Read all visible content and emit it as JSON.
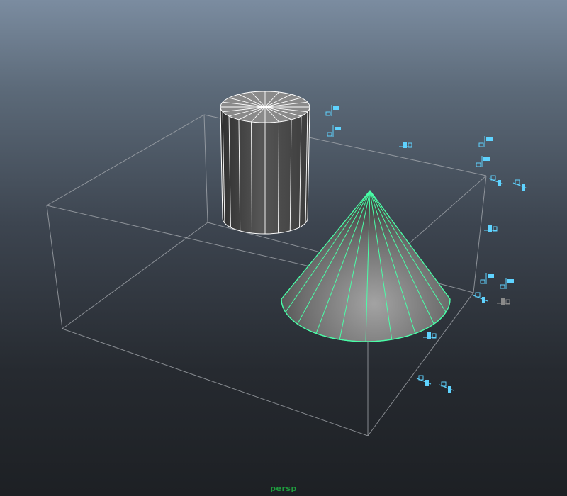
{
  "viewport": {
    "camera_label": "persp"
  },
  "colors": {
    "bounding_box": "#a9adb2",
    "cylinder_wire": "#ffffff",
    "cylinder_fill_dark": "#3b3b3b",
    "cylinder_fill_light": "#5f5f5f",
    "cone_wire": "#49ffa8",
    "cone_fill_dark": "#484848",
    "cone_fill_light": "#9a9a9a",
    "handle": "#5fd3ff",
    "handle_inactive": "#8a8a8a",
    "camera_label": "#1f9b3e"
  },
  "objects": [
    {
      "name": "cylinder",
      "selected": false,
      "spans": 20
    },
    {
      "name": "cone",
      "selected": true,
      "spans": 20
    }
  ],
  "icons": {
    "bounding_box": "bounding-box-wireframe",
    "handles": "manipulator-handle-icon"
  }
}
